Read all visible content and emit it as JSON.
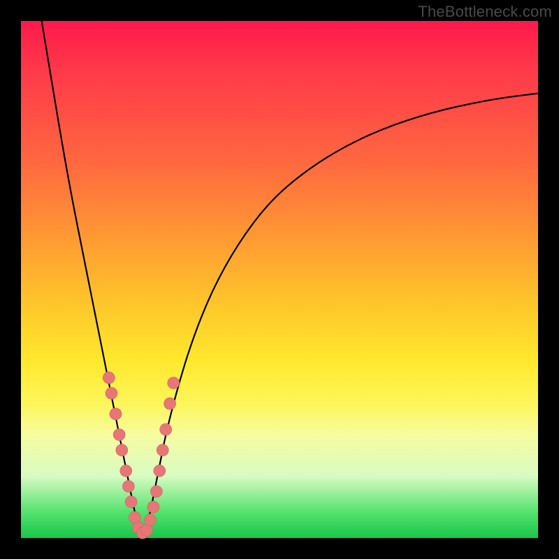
{
  "watermark": "TheBottleneck.com",
  "colors": {
    "marker_fill": "#e77676",
    "marker_stroke": "#d46060",
    "curve_stroke": "#000000"
  },
  "chart_data": {
    "type": "line",
    "title": "",
    "xlabel": "",
    "ylabel": "",
    "xlim": [
      0,
      100
    ],
    "ylim": [
      0,
      100
    ],
    "grid": false,
    "legend": false,
    "annotations": [
      "TheBottleneck.com"
    ],
    "series": [
      {
        "name": "left-branch",
        "x": [
          4,
          6,
          8,
          10,
          12,
          14,
          16,
          17,
          18,
          19,
          20,
          21,
          22,
          23
        ],
        "y": [
          100,
          88,
          76,
          65,
          55,
          45,
          35,
          30,
          25,
          20,
          15,
          10,
          5,
          1
        ]
      },
      {
        "name": "right-branch",
        "x": [
          24,
          25,
          26,
          27,
          28,
          30,
          33,
          37,
          42,
          48,
          55,
          63,
          72,
          82,
          92,
          100
        ],
        "y": [
          1,
          5,
          10,
          15,
          20,
          28,
          38,
          48,
          57,
          65,
          71,
          76,
          80,
          83,
          85,
          86
        ]
      }
    ],
    "markers": [
      {
        "x": 17.0,
        "y": 31
      },
      {
        "x": 17.5,
        "y": 28
      },
      {
        "x": 18.3,
        "y": 24
      },
      {
        "x": 19.0,
        "y": 20
      },
      {
        "x": 19.5,
        "y": 17
      },
      {
        "x": 20.3,
        "y": 13
      },
      {
        "x": 20.8,
        "y": 10
      },
      {
        "x": 21.3,
        "y": 7
      },
      {
        "x": 22.0,
        "y": 4
      },
      {
        "x": 22.7,
        "y": 2
      },
      {
        "x": 23.5,
        "y": 1
      },
      {
        "x": 24.3,
        "y": 1.5
      },
      {
        "x": 25.0,
        "y": 3.5
      },
      {
        "x": 25.6,
        "y": 6
      },
      {
        "x": 26.2,
        "y": 9
      },
      {
        "x": 26.8,
        "y": 13
      },
      {
        "x": 27.4,
        "y": 17
      },
      {
        "x": 28.0,
        "y": 21
      },
      {
        "x": 28.8,
        "y": 26
      },
      {
        "x": 29.5,
        "y": 30
      }
    ],
    "marker_radius": 8.5
  }
}
